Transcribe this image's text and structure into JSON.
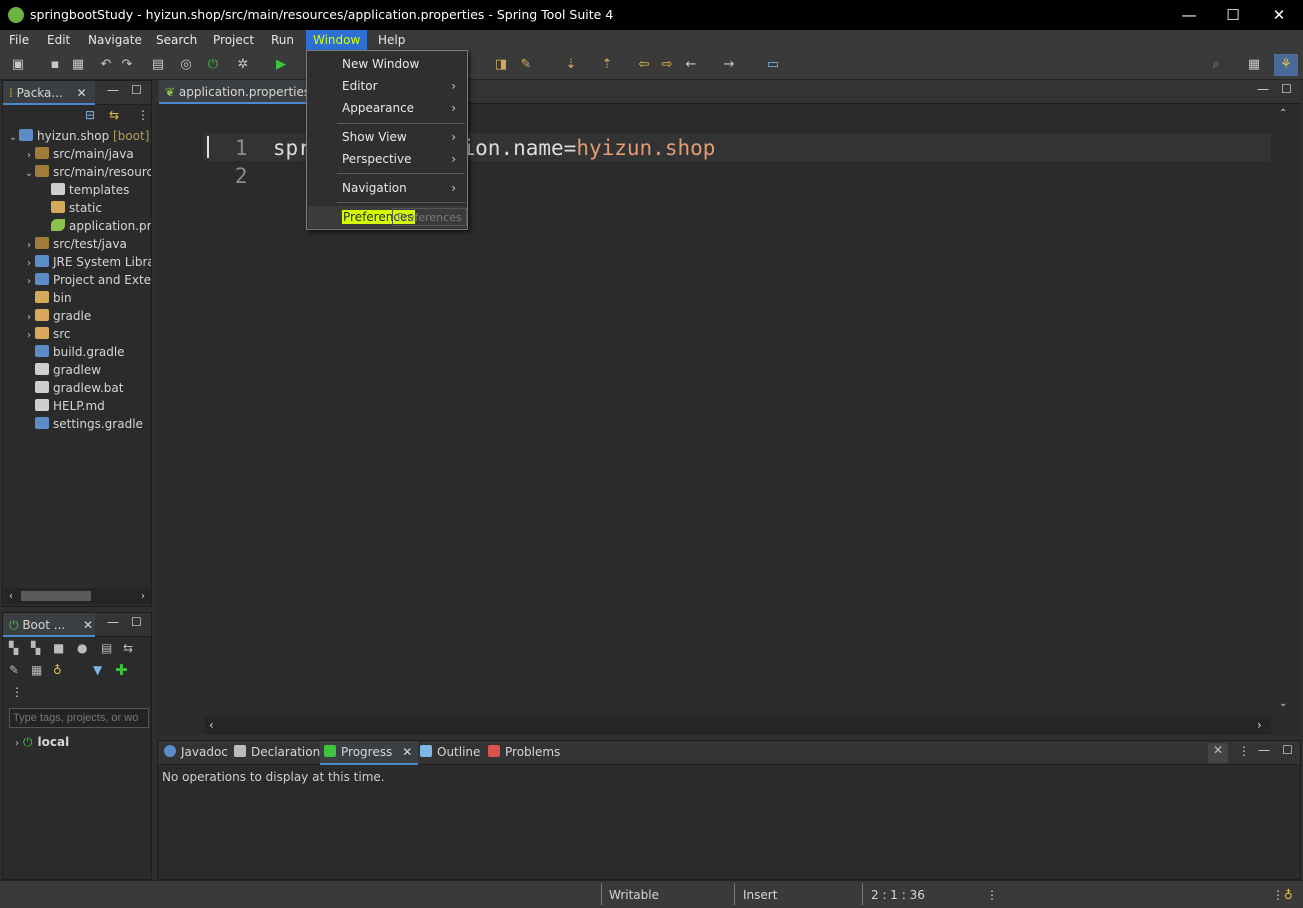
{
  "window": {
    "title": "springbootStudy - hyizun.shop/src/main/resources/application.properties - Spring Tool Suite 4",
    "minimize": "—",
    "maximize": "☐",
    "close": "✕"
  },
  "menubar": {
    "items": [
      "File",
      "Edit",
      "Navigate",
      "Search",
      "Project",
      "Run",
      "Window",
      "Help"
    ],
    "active": "Window"
  },
  "window_menu": {
    "items": [
      {
        "label": "New Window",
        "submenu": false
      },
      {
        "label": "Editor",
        "submenu": true
      },
      {
        "label": "Appearance",
        "submenu": true
      },
      {
        "label": "Show View",
        "submenu": true
      },
      {
        "label": "Perspective",
        "submenu": true
      },
      {
        "label": "Navigation",
        "submenu": true
      },
      {
        "label": "Preferences",
        "submenu": false,
        "highlighted": true
      }
    ],
    "ghost_label": "Preferences"
  },
  "package_explorer": {
    "tab_label": "Packa...",
    "project": {
      "name": "hyizun.shop",
      "tag": "[boot]"
    },
    "tree": [
      {
        "label": "src/main/java",
        "indent": 1,
        "expanded": false,
        "icon": "package-folder-icon"
      },
      {
        "label": "src/main/resources",
        "indent": 1,
        "expanded": true,
        "icon": "package-folder-icon"
      },
      {
        "label": "templates",
        "indent": 2,
        "expanded": null,
        "icon": "templates-icon"
      },
      {
        "label": "static",
        "indent": 2,
        "expanded": null,
        "icon": "folder-icon"
      },
      {
        "label": "application.properties",
        "indent": 2,
        "expanded": null,
        "icon": "properties-file-icon"
      },
      {
        "label": "src/test/java",
        "indent": 1,
        "expanded": false,
        "icon": "package-folder-icon"
      },
      {
        "label": "JRE System Library",
        "indent": 1,
        "expanded": false,
        "icon": "library-icon"
      },
      {
        "label": "Project and External Dependencies",
        "indent": 1,
        "expanded": false,
        "icon": "library-icon"
      },
      {
        "label": "bin",
        "indent": 1,
        "expanded": null,
        "icon": "folder-icon"
      },
      {
        "label": "gradle",
        "indent": 1,
        "expanded": false,
        "icon": "folder-icon"
      },
      {
        "label": "src",
        "indent": 1,
        "expanded": false,
        "icon": "folder-icon"
      },
      {
        "label": "build.gradle",
        "indent": 1,
        "expanded": null,
        "icon": "gradle-file-icon"
      },
      {
        "label": "gradlew",
        "indent": 1,
        "expanded": null,
        "icon": "file-icon"
      },
      {
        "label": "gradlew.bat",
        "indent": 1,
        "expanded": null,
        "icon": "bat-file-icon"
      },
      {
        "label": "HELP.md",
        "indent": 1,
        "expanded": null,
        "icon": "markdown-file-icon"
      },
      {
        "label": "settings.gradle",
        "indent": 1,
        "expanded": null,
        "icon": "gradle-file-icon"
      }
    ]
  },
  "boot_dashboard": {
    "tab_label": "Boot ...",
    "search_placeholder": "Type tags, projects, or wo",
    "local_label": "local"
  },
  "editor": {
    "tab_label": "application.properties",
    "lines": [
      {
        "num": "1",
        "key": "spring.application.name=",
        "value": "hyizun.shop"
      },
      {
        "num": "2",
        "key": "",
        "value": ""
      }
    ],
    "visible_key_start": "spring.a",
    "visible_key_end": "ame="
  },
  "bottom_panel": {
    "tabs": [
      "Javadoc",
      "Declaration",
      "Progress",
      "Outline",
      "Problems"
    ],
    "active": "Progress",
    "message": "No operations to display at this time."
  },
  "statusbar": {
    "writable": "Writable",
    "insert": "Insert",
    "position": "2 : 1 : 36"
  },
  "colors": {
    "accent": "#2d6fd2",
    "highlight": "#d5ff00",
    "code_value": "#e59b6f"
  }
}
